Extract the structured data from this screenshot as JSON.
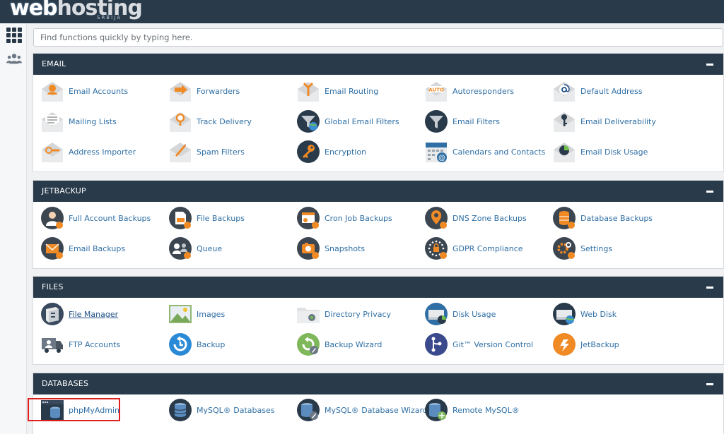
{
  "brand": {
    "name_part1": "web",
    "name_part2": "hosting",
    "sub": "SRBIJA"
  },
  "search": {
    "placeholder": "Find functions quickly by typing here."
  },
  "colors": {
    "header": "#293a4a",
    "link": "#2f6fa5",
    "accent_orange": "#f08a24",
    "highlight": "#e01f1f"
  },
  "sidebar": {
    "items": [
      {
        "icon": "grid-icon"
      },
      {
        "icon": "users-icon"
      }
    ]
  },
  "sections": {
    "email": {
      "title": "EMAIL",
      "items": [
        {
          "label": "Email Accounts",
          "icon": "email-accounts-icon"
        },
        {
          "label": "Forwarders",
          "icon": "forwarders-icon"
        },
        {
          "label": "Email Routing",
          "icon": "email-routing-icon"
        },
        {
          "label": "Autoresponders",
          "icon": "autoresponders-icon"
        },
        {
          "label": "Default Address",
          "icon": "default-address-icon"
        },
        {
          "label": "Mailing Lists",
          "icon": "mailing-lists-icon"
        },
        {
          "label": "Track Delivery",
          "icon": "track-delivery-icon"
        },
        {
          "label": "Global Email Filters",
          "icon": "global-email-filters-icon"
        },
        {
          "label": "Email Filters",
          "icon": "email-filters-icon"
        },
        {
          "label": "Email Deliverability",
          "icon": "email-deliverability-icon"
        },
        {
          "label": "Address Importer",
          "icon": "address-importer-icon"
        },
        {
          "label": "Spam Filters",
          "icon": "spam-filters-icon"
        },
        {
          "label": "Encryption",
          "icon": "encryption-icon"
        },
        {
          "label": "Calendars and Contacts",
          "icon": "calendars-contacts-icon"
        },
        {
          "label": "Email Disk Usage",
          "icon": "email-disk-usage-icon"
        }
      ],
      "autoresponder_badge": "AUTO"
    },
    "jetbackup": {
      "title": "JETBACKUP",
      "items": [
        {
          "label": "Full Account Backups",
          "icon": "full-account-backups-icon"
        },
        {
          "label": "File Backups",
          "icon": "file-backups-icon"
        },
        {
          "label": "Cron Job Backups",
          "icon": "cron-job-backups-icon"
        },
        {
          "label": "DNS Zone Backups",
          "icon": "dns-zone-backups-icon"
        },
        {
          "label": "Database Backups",
          "icon": "database-backups-icon"
        },
        {
          "label": "Email Backups",
          "icon": "email-backups-icon"
        },
        {
          "label": "Queue",
          "icon": "queue-icon"
        },
        {
          "label": "Snapshots",
          "icon": "snapshots-icon"
        },
        {
          "label": "GDPR Compliance",
          "icon": "gdpr-compliance-icon"
        },
        {
          "label": "Settings",
          "icon": "settings-icon"
        }
      ]
    },
    "files": {
      "title": "FILES",
      "items": [
        {
          "label": "File Manager",
          "icon": "file-manager-icon"
        },
        {
          "label": "Images",
          "icon": "images-icon"
        },
        {
          "label": "Directory Privacy",
          "icon": "directory-privacy-icon"
        },
        {
          "label": "Disk Usage",
          "icon": "disk-usage-icon"
        },
        {
          "label": "Web Disk",
          "icon": "web-disk-icon"
        },
        {
          "label": "FTP Accounts",
          "icon": "ftp-accounts-icon"
        },
        {
          "label": "Backup",
          "icon": "backup-icon"
        },
        {
          "label": "Backup Wizard",
          "icon": "backup-wizard-icon"
        },
        {
          "label": "Git™ Version Control",
          "icon": "git-version-control-icon"
        },
        {
          "label": "JetBackup",
          "icon": "jetbackup-icon"
        }
      ]
    },
    "databases": {
      "title": "DATABASES",
      "items": [
        {
          "label": "phpMyAdmin",
          "icon": "phpmyadmin-icon"
        },
        {
          "label": "MySQL® Databases",
          "icon": "mysql-databases-icon"
        },
        {
          "label": "MySQL® Database Wizard",
          "icon": "mysql-database-wizard-icon"
        },
        {
          "label": "Remote MySQL®",
          "icon": "remote-mysql-icon"
        }
      ]
    }
  }
}
